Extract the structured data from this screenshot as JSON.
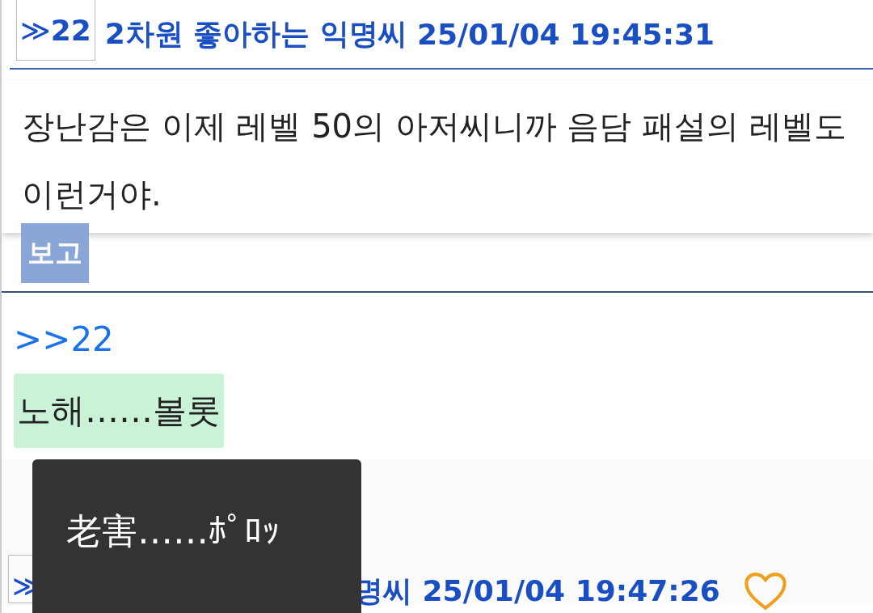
{
  "post_header": {
    "reply_icon": "≫",
    "number": "22",
    "author": "2차원 좋아하는 익명씨",
    "timestamp": "25/01/04 19:45:31"
  },
  "popup": {
    "text": "장난감은 이제 레벨 50의 아저씨니까 음담 패설의 레벨도 이런거야."
  },
  "report_button": "보고",
  "reply": {
    "anchor": ">>22",
    "text": "노해……볼롯",
    "highlighted": true
  },
  "tooltip": {
    "text": "老害……ﾎﾟﾛｯ"
  },
  "next_header": {
    "reply_icon": "≫",
    "visible_text": "명씨 25/01/04 19:47:26",
    "liked": false
  }
}
